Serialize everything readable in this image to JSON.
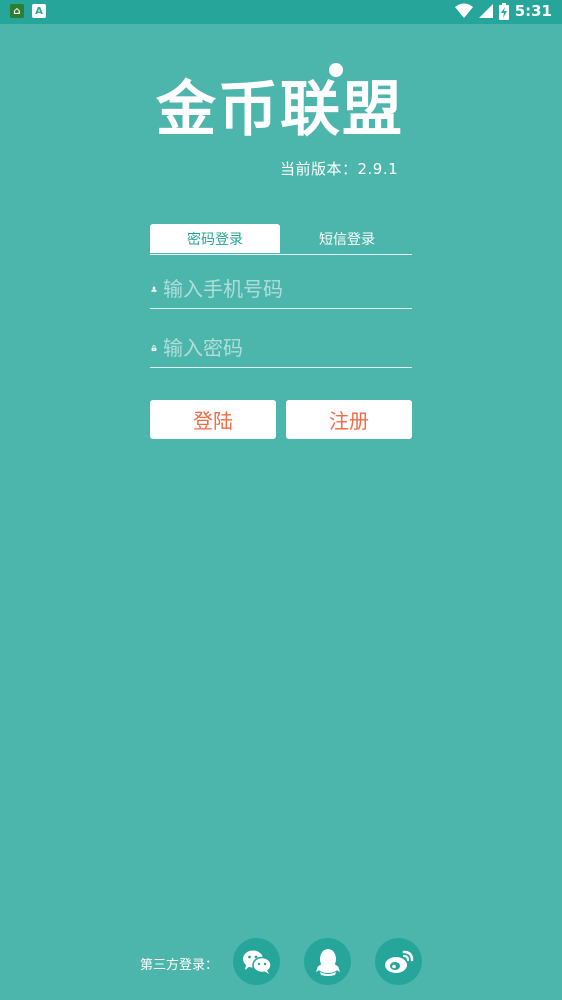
{
  "status_bar": {
    "time": "5:31",
    "left_icons": [
      "app-home-icon",
      "keyboard-a-icon"
    ],
    "right_icons": [
      "wifi-icon",
      "signal-icon",
      "battery-icon"
    ]
  },
  "app": {
    "logo_text": "金币联盟",
    "version_label": "当前版本：2.9.1"
  },
  "login": {
    "tabs": [
      {
        "label": "密码登录",
        "active": true
      },
      {
        "label": "短信登录",
        "active": false
      }
    ],
    "phone_placeholder": "输入手机号码",
    "password_placeholder": "输入密码",
    "login_button": "登陆",
    "register_button": "注册"
  },
  "third_party": {
    "label": "第三方登录：",
    "providers": [
      "wechat-icon",
      "qq-icon",
      "weibo-icon"
    ]
  },
  "colors": {
    "background": "#4db6ac",
    "status_bar": "#26a69a",
    "accent_text": "#ef6c47",
    "social_circle": "#26a69a"
  }
}
